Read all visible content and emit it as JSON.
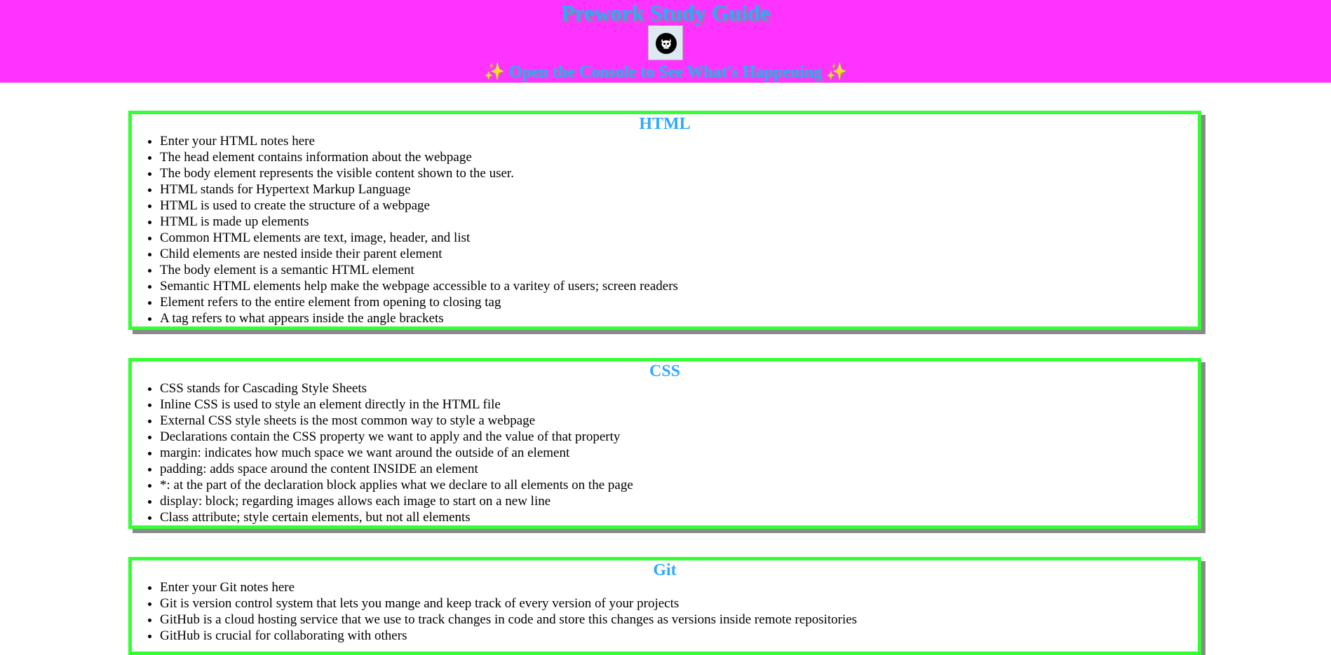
{
  "header": {
    "title": "Prework Study Guide",
    "subtitle": "✨ Open the Console to See What's Happening ✨",
    "avatar_icon": "cat-skull-icon"
  },
  "sections": [
    {
      "title": "HTML",
      "items": [
        "Enter your HTML notes here",
        "The head element contains information about the webpage",
        "The body element represents the visible content shown to the user.",
        "HTML stands for Hypertext Markup Language",
        "HTML is used to create the structure of a webpage",
        "HTML is made up elements",
        "Common HTML elements are text, image, header, and list",
        "Child elements are nested inside their parent element",
        "The body element is a semantic HTML element",
        "Semantic HTML elements help make the webpage accessible to a varitey of users; screen readers",
        "Element refers to the entire element from opening to closing tag",
        "A tag refers to what appears inside the angle brackets"
      ]
    },
    {
      "title": "CSS",
      "items": [
        "CSS stands for Cascading Style Sheets",
        "Inline CSS is used to style an element directly in the HTML file",
        "External CSS style sheets is the most common way to style a webpage",
        "Declarations contain the CSS property we want to apply and the value of that property",
        "margin: indicates how much space we want around the outside of an element",
        "padding: adds space around the content INSIDE an element",
        "*: at the part of the declaration block applies what we declare to all elements on the page",
        "display: block; regarding images allows each image to start on a new line",
        "Class attribute; style certain elements, but not all elements"
      ]
    },
    {
      "title": "Git",
      "items": [
        "Enter your Git notes here",
        "Git is version control system that lets you mange and keep track of every version of your projects",
        "GitHub is a cloud hosting service that we use to track changes in code and store this changes as versions inside remote repositories",
        "GitHub is crucial for collaborating with others"
      ]
    }
  ],
  "colors": {
    "header_bg": "#ff33ff",
    "heading_text": "#2fa8ff",
    "card_border": "#33ff33",
    "card_shadow": "#8a8a8a"
  }
}
